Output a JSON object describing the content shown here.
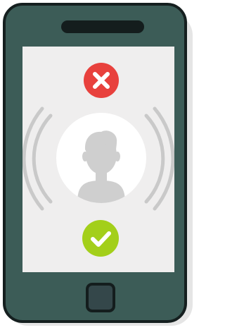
{
  "colors": {
    "phone_body": "#3c5c57",
    "phone_outline": "#151f1f",
    "screen": "#efeeee",
    "decline": "#e8413d",
    "accept": "#a3cf1a",
    "avatar_background": "#ffffff",
    "silhouette": "#cfcfcf",
    "wave": "#c9c9c9"
  },
  "icons": {
    "decline": "close-icon",
    "accept": "check-icon",
    "caller": "user-silhouette-icon",
    "ringing_left": "signal-waves-left-icon",
    "ringing_right": "signal-waves-right-icon"
  }
}
